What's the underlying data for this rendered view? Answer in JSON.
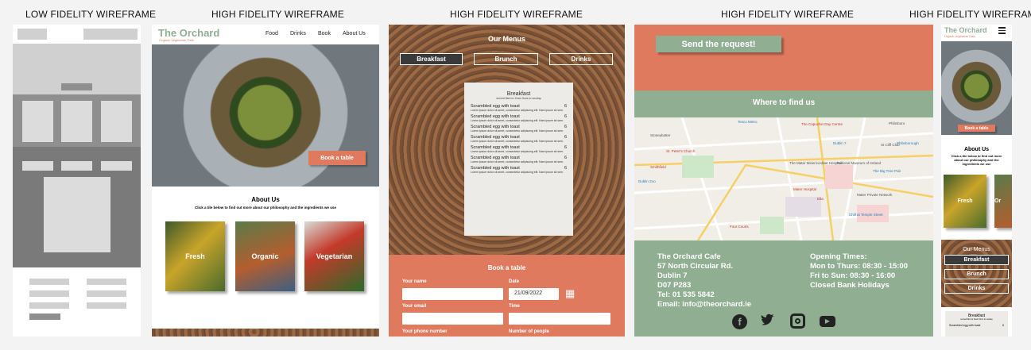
{
  "labels": {
    "low": "LOW FIDELITY WIREFRAME",
    "high1": "HIGH FIDELITY WIREFRAME",
    "high2": "HIGH FIDELITY WIREFRAME",
    "high3": "HIGH FIDELITY WIREFRAME",
    "high4": "HIGH FIDELITY WIREFRAME"
  },
  "home": {
    "brand": "The Orchard",
    "tagline": "Organic Vegetarian Cafe",
    "nav": [
      "Food",
      "Drinks",
      "Book",
      "About Us"
    ],
    "book_btn": "Book a table",
    "about_title": "About Us",
    "about_text": "Click a tile below to find out more about our philosophy and the ingredients we use",
    "tiles": [
      "Fresh",
      "Organic",
      "Vegetarian"
    ]
  },
  "menu": {
    "title": "Our Menus",
    "tabs": [
      "Breakfast",
      "Brunch",
      "Drinks"
    ],
    "card_title": "Breakfast",
    "card_sub": "served 8am to 11am thurs to sunday",
    "item": "Scrambled egg with toast",
    "price": "6",
    "desc": "Lorem ipsum dolor sit amet, consectetur adipiscing elit. Nam ipsum sit sem.",
    "form_title": "Book a table",
    "f_name": "Your name",
    "f_date": "Date",
    "f_date_val": "21/09/2022",
    "f_email": "Your email",
    "f_time": "Time",
    "f_phone": "Your phone number",
    "f_people": "Number of people"
  },
  "contact": {
    "send_btn": "Send the request!",
    "where": "Where to find us",
    "addr": [
      "The Orchard Cafe",
      "57 North Circular Rd.",
      "Dublin 7",
      "D07 P283",
      "Tel: 01 535 5842",
      "Email: info@theorchard.ie"
    ],
    "hours": [
      "Opening Times:",
      "Mon to Thurs: 08:30 - 15:00",
      "Fri to Sun: 08:30 - 16:00",
      "Closed Bank Holidays"
    ],
    "map_labels": [
      "Tesco Metro",
      "The Capuchin Day Centre",
      "Stoneybatter",
      "Dublin 7",
      "Smithfield",
      "National Museum of Ireland",
      "Phibsborough",
      "St. Peter's Church",
      "The Mater Misericordiae Hospital",
      "The Big Tree Pub",
      "Mater Hospital",
      "St Cliff Club",
      "Dublin Zoo",
      "Four Courts",
      "Mater Private Network",
      "Chill at Temple Street",
      "Elta",
      "Phibsboro"
    ]
  },
  "mobile": {
    "brand": "The Orchard",
    "tagline": "Organic Vegetarian Cafe",
    "book_btn": "Book a table",
    "about_title": "About Us",
    "about_text": "Click a tile below to find out more about our philosophy and the ingredients we use",
    "tile": "Fresh",
    "tile2": "Or",
    "menu_title": "Our Menus",
    "tabs": [
      "Breakfast",
      "Brunch",
      "Drinks"
    ],
    "card_title": "Breakfast",
    "card_sub": "served 8am to 11am thurs to sunday",
    "item": "Scrambled egg with toast",
    "price": "6"
  },
  "colors": {
    "sage": "#8fae92",
    "coral": "#e07a5f"
  }
}
